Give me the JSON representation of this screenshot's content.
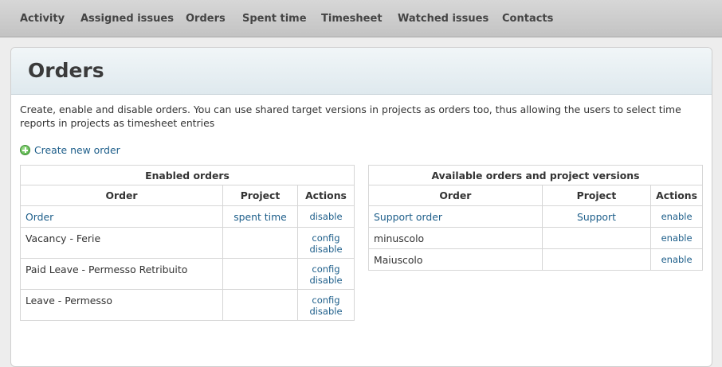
{
  "topnav": {
    "items": [
      "Activity",
      "Assigned issues",
      "Orders",
      "Spent time",
      "Timesheet",
      "Watched issues",
      "Contacts"
    ]
  },
  "page": {
    "title": "Orders",
    "description": "Create, enable and disable orders. You can use shared target versions in projects as orders too, thus allowing the users to select time reports in projects as timesheet entries",
    "create_link": "Create new order"
  },
  "enabled_table": {
    "caption": "Enabled orders",
    "headers": [
      "Order",
      "Project",
      "Actions"
    ],
    "rows": [
      {
        "order": "Order",
        "project": "spent time",
        "actions": [
          "disable"
        ]
      },
      {
        "order": "Vacancy - Ferie",
        "project": "",
        "actions": [
          "config",
          "disable"
        ]
      },
      {
        "order": "Paid Leave - Permesso Retribuito",
        "project": "",
        "actions": [
          "config",
          "disable"
        ]
      },
      {
        "order": "Leave - Permesso",
        "project": "",
        "actions": [
          "config",
          "disable"
        ]
      }
    ]
  },
  "available_table": {
    "caption": "Available orders and project versions",
    "headers": [
      "Order",
      "Project",
      "Actions"
    ],
    "rows": [
      {
        "order": "Support order",
        "project": "Support",
        "actions": [
          "enable"
        ]
      },
      {
        "order": "minuscolo",
        "project": "",
        "actions": [
          "enable"
        ]
      },
      {
        "order": "Maiuscolo",
        "project": "",
        "actions": [
          "enable"
        ]
      }
    ]
  },
  "colors": {
    "link": "#1d5e8a",
    "nav_bg": "#cccccc",
    "header_bg": "#e6eef2"
  }
}
